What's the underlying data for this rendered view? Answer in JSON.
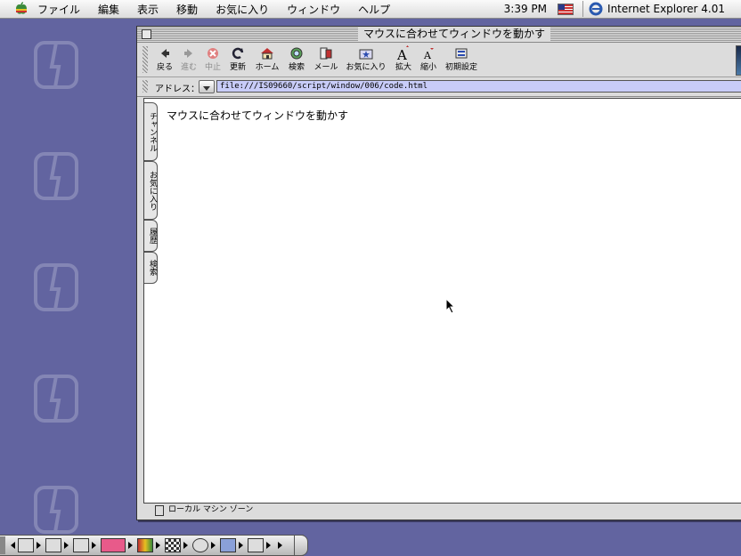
{
  "menubar": {
    "items": [
      "ファイル",
      "編集",
      "表示",
      "移動",
      "お気に入り",
      "ウィンドウ",
      "ヘルプ"
    ],
    "clock": "3:39 PM",
    "app_name": "Internet Explorer 4.01"
  },
  "window": {
    "title": "マウスに合わせてウィンドウを動かす"
  },
  "toolbar": {
    "buttons": [
      {
        "label": "戻る",
        "icon": "back-arrow-icon",
        "enabled": true
      },
      {
        "label": "進む",
        "icon": "forward-arrow-icon",
        "enabled": false
      },
      {
        "label": "中止",
        "icon": "stop-icon",
        "enabled": false
      },
      {
        "label": "更新",
        "icon": "refresh-icon",
        "enabled": true
      },
      {
        "label": "ホーム",
        "icon": "home-icon",
        "enabled": true
      },
      {
        "label": "検索",
        "icon": "search-icon",
        "enabled": true
      },
      {
        "label": "メール",
        "icon": "mail-icon",
        "enabled": true
      },
      {
        "label": "お気に入り",
        "icon": "favorites-icon",
        "enabled": true
      },
      {
        "label": "拡大",
        "icon": "text-larger-icon",
        "enabled": true
      },
      {
        "label": "縮小",
        "icon": "text-smaller-icon",
        "enabled": true
      },
      {
        "label": "初期設定",
        "icon": "preferences-icon",
        "enabled": true
      }
    ]
  },
  "address": {
    "label": "アドレス：",
    "url": "file:///IS09660/script/window/006/code.html"
  },
  "sidebar_tabs": [
    "チャンネル",
    "お気に入り",
    "履歴",
    "検索"
  ],
  "page": {
    "text": "マウスに合わせてウィンドウを動かす"
  },
  "status": {
    "text": "ローカル マシン ゾーン"
  },
  "colors": {
    "desktop": "#6264a0",
    "address_field": "#c8ccf8"
  }
}
